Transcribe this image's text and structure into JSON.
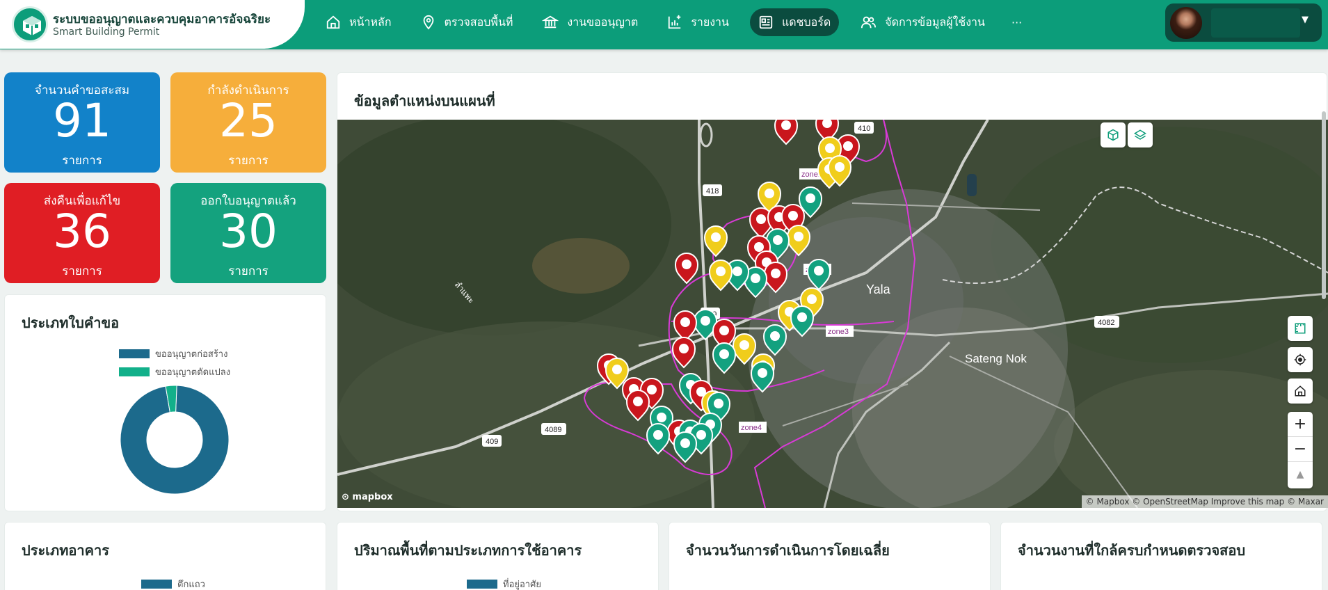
{
  "header": {
    "title": "ระบบขออนุญาตและควบคุมอาคารอัจฉริยะ",
    "subtitle": "Smart Building Permit",
    "nav": [
      {
        "label": "หน้าหลัก",
        "icon": "home-icon"
      },
      {
        "label": "ตรวจสอบพื้นที่",
        "icon": "map-pin-icon"
      },
      {
        "label": "งานขออนุญาต",
        "icon": "bank-icon"
      },
      {
        "label": "รายงาน",
        "icon": "report-icon"
      },
      {
        "label": "แดชบอร์ด",
        "icon": "dashboard-icon",
        "active": true
      },
      {
        "label": "จัดการข้อมูลผู้ใช้งาน",
        "icon": "users-icon"
      }
    ],
    "more": "···"
  },
  "stats": [
    {
      "label": "จำนวนคำขอสะสม",
      "value": "91",
      "unit": "รายการ",
      "color": "#1282c9"
    },
    {
      "label": "กำลังดำเนินการ",
      "value": "25",
      "unit": "รายการ",
      "color": "#f6ae3b"
    },
    {
      "label": "ส่งคืนเพื่อแก้ไข",
      "value": "36",
      "unit": "รายการ",
      "color": "#e01e24"
    },
    {
      "label": "ออกใบอนุญาตแล้ว",
      "value": "30",
      "unit": "รายการ",
      "color": "#14a27e"
    }
  ],
  "request_type": {
    "title": "ประเภทใบคำขอ",
    "legend": [
      {
        "name": "ขออนุญาตก่อสร้าง",
        "color": "#1c6a8c"
      },
      {
        "name": "ขออนุญาตดัดแปลง",
        "color": "#12b08a"
      }
    ]
  },
  "chart_data": {
    "type": "pie",
    "donut": true,
    "categories": [
      "ขออนุญาตก่อสร้าง",
      "ขออนุญาตดัดแปลง"
    ],
    "values": [
      88,
      3
    ],
    "colors": [
      "#1c6a8c",
      "#12b08a"
    ]
  },
  "map": {
    "title": "ข้อมูลตำแหน่งบนแผนที่",
    "place_labels": [
      "Yala",
      "Sateng Nok",
      "ลำแพะ"
    ],
    "zone_labels": [
      "zone1",
      "zone2",
      "zone3",
      "zone4"
    ],
    "road_labels": [
      "410",
      "418",
      "409",
      "409",
      "4089",
      "4082"
    ],
    "attribution": "© Mapbox © OpenStreetMap Improve this map © Maxar",
    "logo": "mapbox",
    "zoom_in": "+",
    "zoom_out": "−"
  },
  "bottom_cards": [
    {
      "title": "ประเภทอาคาร",
      "legend": "ตึกแถว"
    },
    {
      "title": "ปริมาณพื้นที่ตามประเภทการใช้อาคาร",
      "legend": "ที่อยู่อาศัย"
    },
    {
      "title": "จำนวนวันการดำเนินการโดยเฉลี่ย"
    },
    {
      "title": "จำนวนงานที่ใกล้ครบกำหนดตรวจสอบ"
    }
  ]
}
